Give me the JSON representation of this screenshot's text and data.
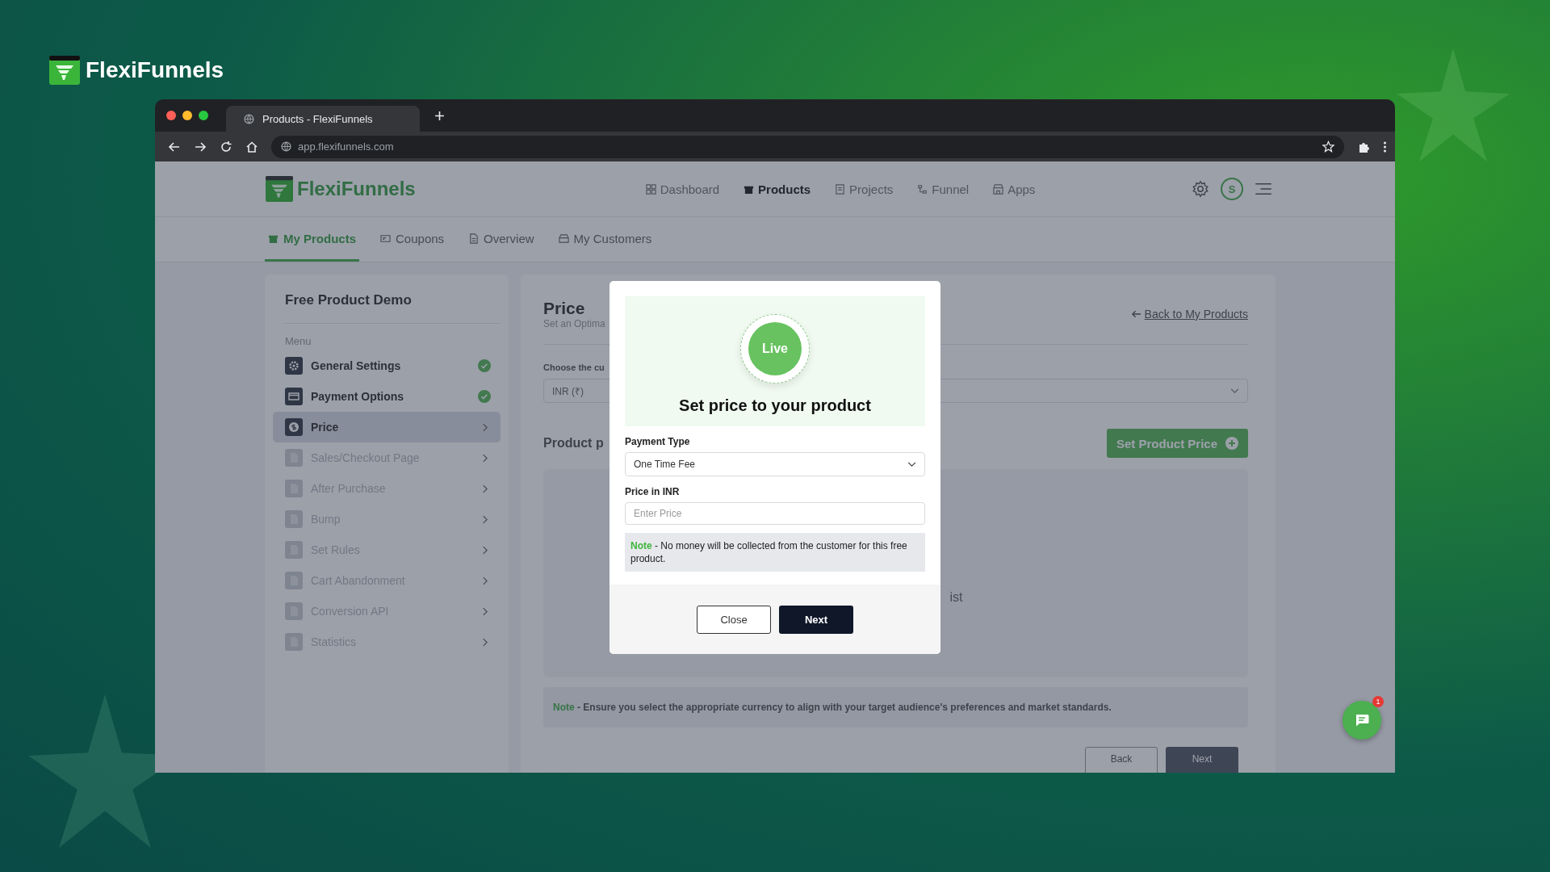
{
  "brand": {
    "name": "FlexiFunnels"
  },
  "browser": {
    "tab_title": "Products - FlexiFunnels",
    "url": "app.flexifunnels.com"
  },
  "app_header": {
    "brand": "FlexiFunnels",
    "avatar_letter": "S",
    "nav": [
      {
        "label": "Dashboard",
        "selected": false
      },
      {
        "label": "Products",
        "selected": true
      },
      {
        "label": "Projects",
        "selected": false
      },
      {
        "label": "Funnel",
        "selected": false
      },
      {
        "label": "Apps",
        "selected": false
      }
    ]
  },
  "subnav": [
    {
      "label": "My Products",
      "selected": true
    },
    {
      "label": "Coupons",
      "selected": false
    },
    {
      "label": "Overview",
      "selected": false
    },
    {
      "label": "My Customers",
      "selected": false
    }
  ],
  "sidebar": {
    "title": "Free Product Demo",
    "menu_label": "Menu",
    "items": [
      {
        "label": "General Settings",
        "selected": false,
        "done": true,
        "disabled": false
      },
      {
        "label": "Payment Options",
        "selected": false,
        "done": true,
        "disabled": false
      },
      {
        "label": "Price",
        "selected": true,
        "done": false,
        "disabled": false
      },
      {
        "label": "Sales/Checkout Page",
        "selected": false,
        "done": false,
        "disabled": true
      },
      {
        "label": "After Purchase",
        "selected": false,
        "done": false,
        "disabled": true
      },
      {
        "label": "Bump",
        "selected": false,
        "done": false,
        "disabled": true
      },
      {
        "label": "Set Rules",
        "selected": false,
        "done": false,
        "disabled": true
      },
      {
        "label": "Cart Abandonment",
        "selected": false,
        "done": false,
        "disabled": true
      },
      {
        "label": "Conversion API",
        "selected": false,
        "done": false,
        "disabled": true
      },
      {
        "label": "Statistics",
        "selected": false,
        "done": false,
        "disabled": true
      }
    ]
  },
  "main": {
    "title": "Price",
    "subtitle": "Set an Optima",
    "back_link": "Back to My Products",
    "currency_label": "Choose the cu",
    "currency_value": "INR (₹)",
    "section_title": "Product p",
    "set_price_button": "Set Product Price",
    "empty_text": "ist",
    "note": "**Note** - Ensure you select the appropriate currency to align with your target audience's preferences and market standards.",
    "buttons": [
      "Back",
      "Next"
    ]
  },
  "modal": {
    "badge": "Live",
    "title": "Set price to your product",
    "payment_type": {
      "label": "Payment Type",
      "value": "One Time Fee"
    },
    "price": {
      "label": "Price in INR",
      "placeholder": "Enter Price"
    },
    "note": "**Note** - No money will be collected from the customer for this free product.",
    "buttons": [
      "Close",
      "Next"
    ]
  },
  "chat": {
    "badge": "1"
  }
}
